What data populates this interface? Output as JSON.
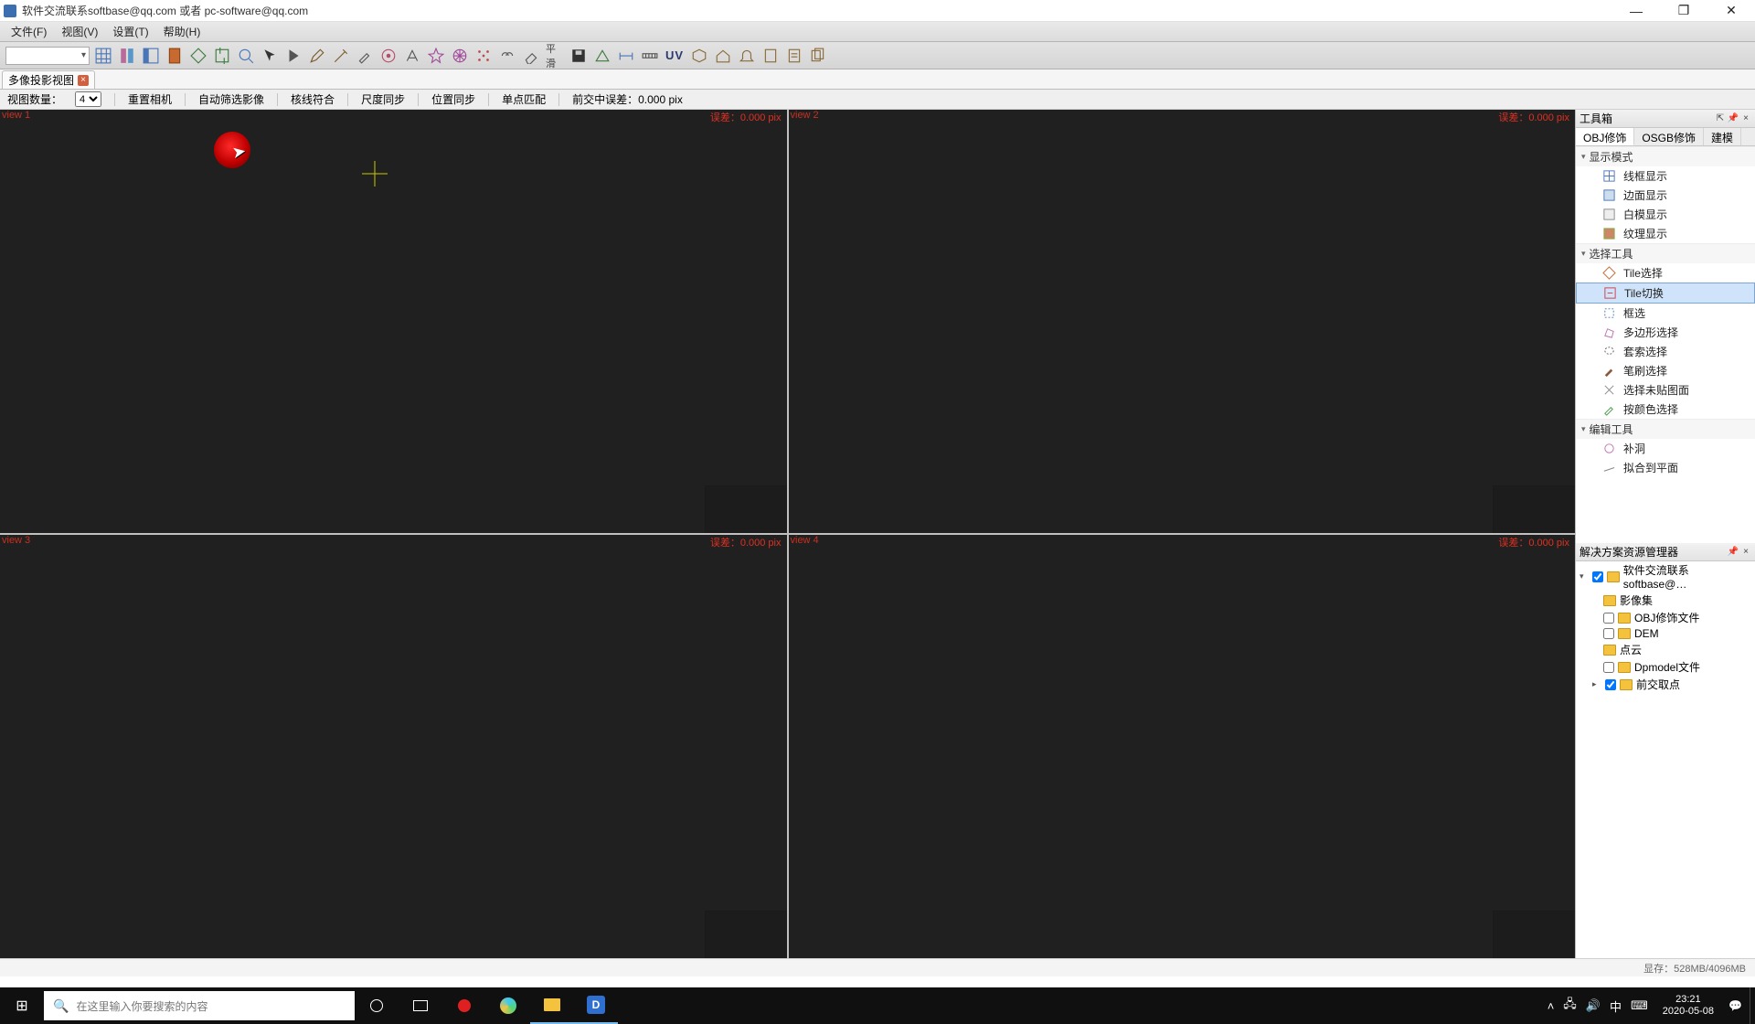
{
  "window": {
    "title": "软件交流联系softbase@qq.com 或者 pc-software@qq.com"
  },
  "menubar": [
    "文件(F)",
    "视图(V)",
    "设置(T)",
    "帮助(H)"
  ],
  "tabs": {
    "active": "多像投影视图"
  },
  "optbar": {
    "view_count_label": "视图数量：",
    "view_count_value": "4",
    "reset_camera": "重置相机",
    "auto_filter": "自动筛选影像",
    "epipolar": "核线符合",
    "scale_sync": "尺度同步",
    "pos_sync": "位置同步",
    "single_match": "单点匹配",
    "forward_err_label": "前交中误差：",
    "forward_err_value": "0.000 pix"
  },
  "views": {
    "v1": {
      "title": "view 1",
      "err": "误差：0.000 pix"
    },
    "v2": {
      "title": "view 2",
      "err": "误差：0.000 pix"
    },
    "v3": {
      "title": "view 3",
      "err": "误差：0.000 pix"
    },
    "v4": {
      "title": "view 4",
      "err": "误差：0.000 pix"
    }
  },
  "toolbox": {
    "header": "工具箱",
    "tabs": [
      "OBJ修饰",
      "OSGB修饰",
      "建模"
    ],
    "group_display": "显示模式",
    "display_items": [
      "线框显示",
      "边面显示",
      "白模显示",
      "纹理显示"
    ],
    "group_select": "选择工具",
    "select_items": [
      "Tile选择",
      "Tile切换",
      "框选",
      "多边形选择",
      "套索选择",
      "笔刷选择",
      "选择未贴图面",
      "按颜色选择"
    ],
    "group_edit": "编辑工具",
    "edit_items": [
      "补洞",
      "拟合到平面"
    ]
  },
  "explorer": {
    "header": "解决方案资源管理器",
    "root": "软件交流联系softbase@…",
    "nodes": [
      "影像集",
      "OBJ修饰文件",
      "DEM",
      "点云",
      "Dpmodel文件",
      "前交取点"
    ]
  },
  "statusbar": {
    "mem": "显存：528MB/4096MB"
  },
  "taskbar": {
    "search_placeholder": "在这里输入你要搜索的内容",
    "ime": "中",
    "time": "23:21",
    "date": "2020-05-08"
  }
}
